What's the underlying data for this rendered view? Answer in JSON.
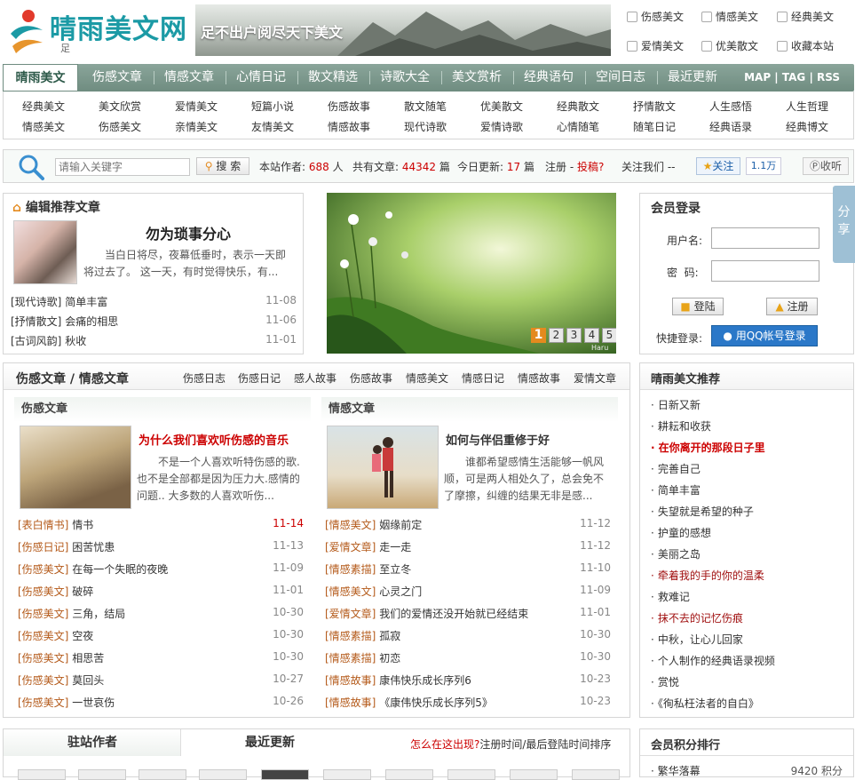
{
  "header": {
    "logo_text": "晴雨美文网",
    "logo_sub": "足",
    "banner_text": "足不出户阅尽天下美文",
    "quick_links": [
      {
        "label": "伤感美文",
        "icon": "user-icon"
      },
      {
        "label": "情感美文",
        "icon": "chat-icon"
      },
      {
        "label": "经典美文",
        "icon": "book-icon"
      },
      {
        "label": "爱情美文",
        "icon": "heart-icon"
      },
      {
        "label": "优美散文",
        "icon": "star-icon"
      },
      {
        "label": "收藏本站",
        "icon": "mail-icon"
      }
    ]
  },
  "nav": {
    "home": "晴雨美文",
    "items": [
      "伤感文章",
      "情感文章",
      "心情日记",
      "散文精选",
      "诗歌大全",
      "美文赏析",
      "经典语句",
      "空间日志",
      "最近更新"
    ],
    "right": "MAP | TAG | RSS"
  },
  "subnav": {
    "row1": [
      "经典美文",
      "美文欣赏",
      "爱情美文",
      "短篇小说",
      "伤感故事",
      "散文随笔",
      "优美散文",
      "经典散文",
      "抒情散文",
      "人生感悟",
      "人生哲理"
    ],
    "row2": [
      "情感美文",
      "伤感美文",
      "亲情美文",
      "友情美文",
      "情感故事",
      "现代诗歌",
      "爱情诗歌",
      "心情随笔",
      "随笔日记",
      "经典语录",
      "经典博文"
    ]
  },
  "search": {
    "placeholder": "请输入关键字",
    "button": "搜 索",
    "authors_label": "本站作者:",
    "authors_count": "688",
    "authors_unit": "人",
    "articles_label": "共有文章:",
    "articles_count": "44342",
    "articles_unit": "篇",
    "today_label": "今日更新:",
    "today_count": "17",
    "today_unit": "篇",
    "register_label": "注册 -",
    "submit_label": "投稿?",
    "follow_us": "关注我们 --",
    "follow_btn": "关注",
    "follow_count": "1.1万",
    "fav_btn": "收听"
  },
  "recommend": {
    "heading": "编辑推荐文章",
    "title": "勿为琐事分心",
    "desc": "当白日将尽，夜幕低垂时，表示一天即将过去了。 这一天，有时觉得快乐，有...",
    "list": [
      {
        "cat": "[现代诗歌]",
        "title": "简单丰富",
        "date": "11-08"
      },
      {
        "cat": "[抒情散文]",
        "title": "会痛的相思",
        "date": "11-06"
      },
      {
        "cat": "[古词风韵]",
        "title": "秋收",
        "date": "11-01"
      }
    ]
  },
  "slider": {
    "pages": [
      "1",
      "2",
      "3",
      "4",
      "5"
    ],
    "active": "1",
    "watermark": "Haru"
  },
  "login": {
    "title": "会员登录",
    "username_label": "用户名:",
    "password_label": "密  码:",
    "login_btn": "登陆",
    "register_btn": "注册",
    "quick_label": "快捷登录:",
    "qq_btn": "用QQ帐号登录"
  },
  "share": {
    "label": "分享"
  },
  "articles": {
    "tab1": "伤感文章",
    "tab_sep": "/",
    "tab2": "情感文章",
    "tags": [
      "伤感日志",
      "伤感日记",
      "感人故事",
      "伤感故事",
      "情感美文",
      "情感日记",
      "情感故事",
      "爱情文章"
    ],
    "left": {
      "head": "伤感文章",
      "feature_title": "为什么我们喜欢听伤感的音乐",
      "feature_desc": "不是一个人喜欢听特伤感的歌.也不是全部都是因为压力大.感情的问题.. 大多数的人喜欢听伤...",
      "rows": [
        {
          "cat": "[表白情书]",
          "title": "情书",
          "date": "11-14"
        },
        {
          "cat": "[伤感日记]",
          "title": "困苦忧患",
          "date": "11-13"
        },
        {
          "cat": "[伤感美文]",
          "title": "在每一个失眠的夜晚",
          "date": "11-09"
        },
        {
          "cat": "[伤感美文]",
          "title": "破碎",
          "date": "11-01"
        },
        {
          "cat": "[伤感美文]",
          "title": "三角，结局",
          "date": "10-30"
        },
        {
          "cat": "[伤感美文]",
          "title": "空夜",
          "date": "10-30"
        },
        {
          "cat": "[伤感美文]",
          "title": "相思苦",
          "date": "10-30"
        },
        {
          "cat": "[伤感美文]",
          "title": "莫回头",
          "date": "10-27"
        },
        {
          "cat": "[伤感美文]",
          "title": "一世哀伤",
          "date": "10-26"
        }
      ]
    },
    "right": {
      "head": "情感文章",
      "feature_title": "如何与伴侣重修于好",
      "feature_desc": "谁都希望感情生活能够一帆风顺，可是两人相处久了，总会免不了摩擦，纠缠的结果无非是感...",
      "rows": [
        {
          "cat": "[情感美文]",
          "title": "姻缘前定",
          "date": "11-12"
        },
        {
          "cat": "[爱情文章]",
          "title": "走一走",
          "date": "11-12"
        },
        {
          "cat": "[情感素描]",
          "title": "至立冬",
          "date": "11-10"
        },
        {
          "cat": "[情感美文]",
          "title": "心灵之门",
          "date": "11-09"
        },
        {
          "cat": "[爱情文章]",
          "title": "我们的爱情还没开始就已经结束",
          "date": "11-01"
        },
        {
          "cat": "[情感素描]",
          "title": "孤寂",
          "date": "10-30"
        },
        {
          "cat": "[情感素描]",
          "title": "初恋",
          "date": "10-30"
        },
        {
          "cat": "[情感故事]",
          "title": "康伟快乐成长序列6",
          "date": "10-23"
        },
        {
          "cat": "[情感故事]",
          "title": "《康伟快乐成长序列5》",
          "date": "10-23"
        }
      ]
    }
  },
  "sidebar": {
    "title": "晴雨美文推荐",
    "items": [
      {
        "label": "日新又新",
        "hot": false
      },
      {
        "label": "耕耘和收获",
        "hot": false
      },
      {
        "label": "在你离开的那段日子里",
        "hot": true
      },
      {
        "label": "完善自己",
        "hot": false
      },
      {
        "label": "简单丰富",
        "hot": false
      },
      {
        "label": "失望就是希望的种子",
        "hot": false
      },
      {
        "label": "护童的感想",
        "hot": false
      },
      {
        "label": "美丽之岛",
        "hot": false
      },
      {
        "label": "牵着我的手的你的温柔",
        "hot": "dark"
      },
      {
        "label": "救难记",
        "hot": false
      },
      {
        "label": "抹不去的记忆伤痕",
        "hot": "dark"
      },
      {
        "label": "中秋，让心儿回家",
        "hot": false
      },
      {
        "label": "个人制作的经典语录视频",
        "hot": false
      },
      {
        "label": "赏悦",
        "hot": false
      },
      {
        "label": "《徇私枉法者的自白》",
        "hot": false
      }
    ]
  },
  "bottom": {
    "tab1": "驻站作者",
    "tab2": "最近更新",
    "note_q": "怎么在这出现?",
    "note_a": "注册时间/最后登陆时间排序",
    "rank_title": "会员积分排行",
    "rank_first_name": "繁华落幕",
    "rank_first_score": "9420 积分"
  },
  "colors": {
    "accent": "#1b9aa5",
    "nav": "#7b978b",
    "red": "#cc0000",
    "category": "#b45a1a"
  }
}
